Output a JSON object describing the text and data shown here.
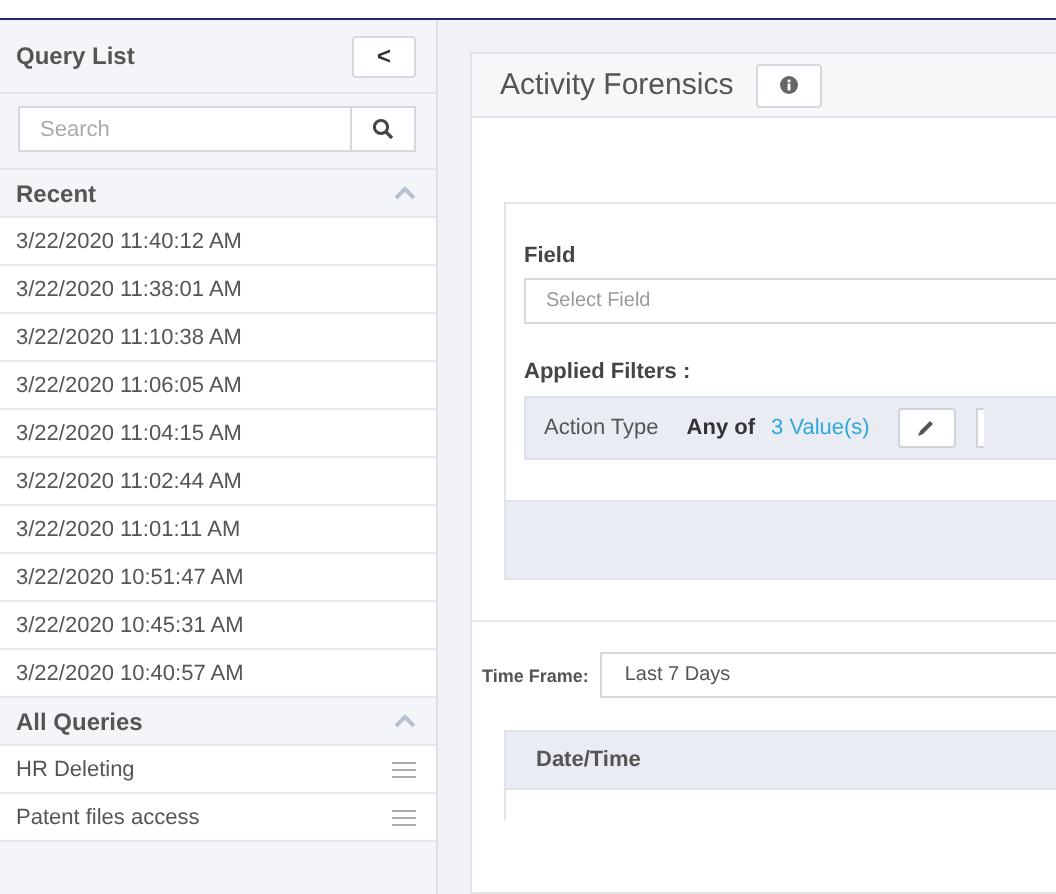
{
  "sidebar": {
    "title": "Query List",
    "collapse_button": "<",
    "search": {
      "placeholder": "Search"
    },
    "sections": [
      {
        "title": "Recent",
        "expanded": true,
        "kind": "recent",
        "items": [
          "3/22/2020 11:40:12 AM",
          "3/22/2020 11:38:01 AM",
          "3/22/2020 11:10:38 AM",
          "3/22/2020 11:06:05 AM",
          "3/22/2020 11:04:15 AM",
          "3/22/2020 11:02:44 AM",
          "3/22/2020 11:01:11 AM",
          "3/22/2020 10:51:47 AM",
          "3/22/2020 10:45:31 AM",
          "3/22/2020 10:40:57 AM"
        ]
      },
      {
        "title": "All Queries",
        "expanded": true,
        "kind": "saved",
        "items": [
          "HR Deleting",
          "Patent files access"
        ]
      }
    ]
  },
  "main": {
    "title": "Activity Forensics",
    "field": {
      "label": "Field",
      "placeholder": "Select Field"
    },
    "applied_filters": {
      "label": "Applied Filters :",
      "filters": [
        {
          "name": "Action Type",
          "operator": "Any of",
          "values": "3 Value(s)"
        }
      ]
    },
    "time_frame": {
      "label": "Time Frame:",
      "value": "Last 7 Days"
    },
    "table": {
      "columns": [
        "Date/Time"
      ]
    }
  }
}
